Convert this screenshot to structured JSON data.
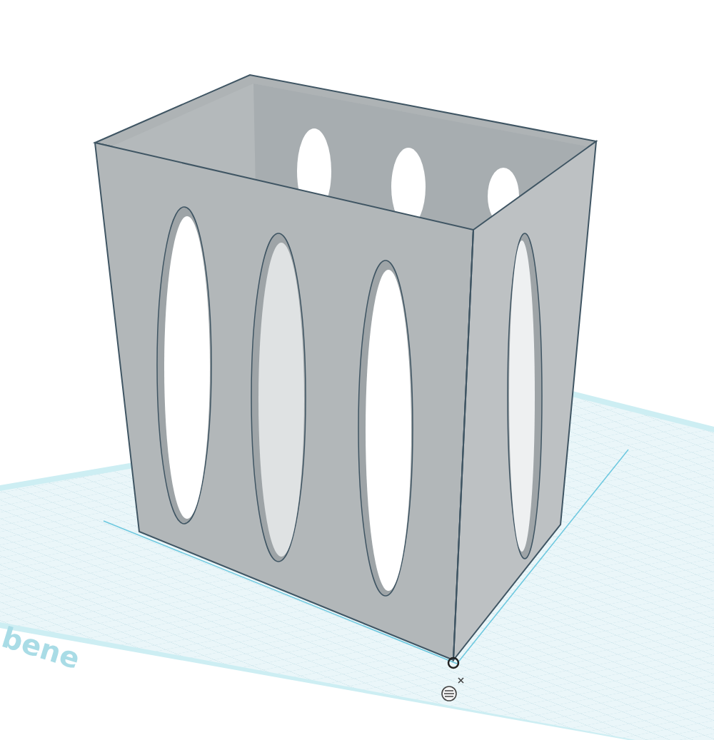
{
  "viewport": {
    "workplane": {
      "label": "bene"
    }
  }
}
